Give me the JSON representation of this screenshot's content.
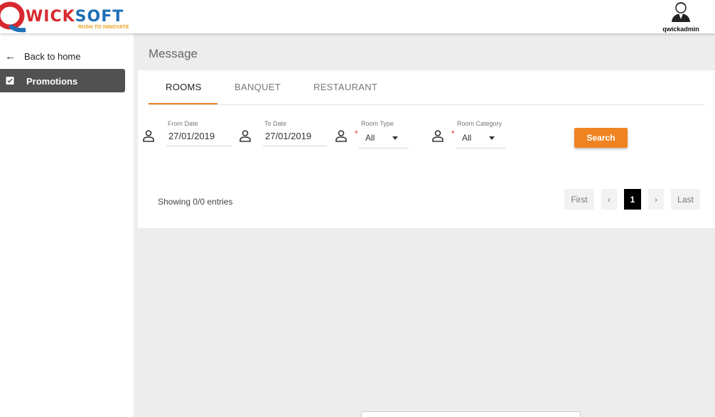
{
  "brand": {
    "logo_letter": "Q",
    "logo_red": "WICK",
    "logo_blue": "SOFT",
    "tagline": "RUSH TO INNOVATE",
    "colors": {
      "red": "#d7282f",
      "blue": "#1e6fb5",
      "accent": "#ef8321"
    }
  },
  "user": {
    "name": "qwickadmin",
    "icon": "user-avatar-icon"
  },
  "sidebar": {
    "back_label": "Back to home",
    "back_icon": "arrow-left-icon",
    "items": [
      {
        "label": "Promotions",
        "icon": "clipboard-check-icon",
        "active": true
      }
    ]
  },
  "page": {
    "title": "Message"
  },
  "tabs": [
    {
      "label": "ROOMS",
      "active": true
    },
    {
      "label": "BANQUET",
      "active": false
    },
    {
      "label": "RESTAURANT",
      "active": false
    }
  ],
  "filters": {
    "from_date": {
      "label": "From Date",
      "value": "27/01/2019",
      "icon": "person-icon"
    },
    "to_date": {
      "label": "To Date",
      "value": "27/01/2019",
      "icon": "person-icon"
    },
    "room_type": {
      "label": "Room Type",
      "value": "All",
      "required_mark": "*",
      "icon": "person-icon"
    },
    "room_category": {
      "label": "Room Category",
      "value": "All",
      "required_mark": "*",
      "icon": "person-icon"
    },
    "search_label": "Search"
  },
  "table": {
    "entries_text": "Showing 0/0 entries"
  },
  "pagination": {
    "first": "First",
    "prev": "‹",
    "current": "1",
    "next": "›",
    "last": "Last"
  }
}
